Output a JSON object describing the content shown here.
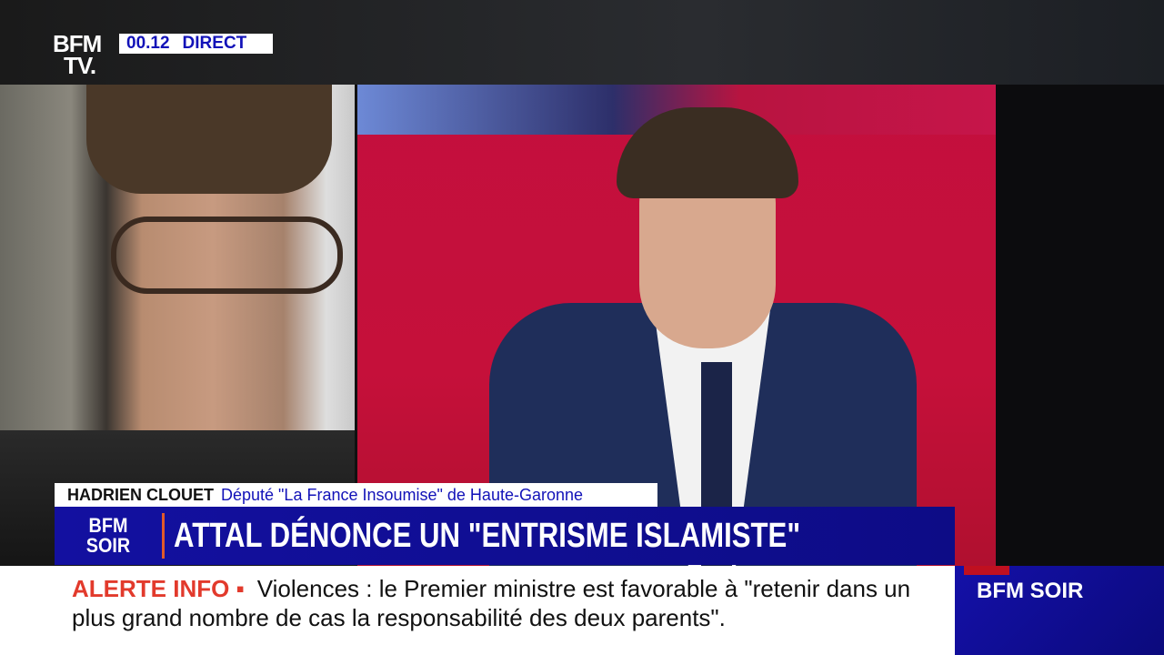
{
  "channel": {
    "logo_line1": "BFM",
    "logo_line2": "TV.",
    "time": "00.12",
    "live": "DIRECT"
  },
  "lower_third": {
    "name": "HADRIEN CLOUET",
    "title": "Député \"La France Insoumise\" de Haute-Garonne"
  },
  "headline": {
    "show_line1": "BFM",
    "show_line2": "SOIR",
    "text": "ATTAL DÉNONCE UN \"ENTRISME ISLAMISTE\""
  },
  "ticker": {
    "label": "ALERTE INFO ▪",
    "text": "Violences : le Premier ministre est favorable à \"retenir dans un plus grand nombre de cas la responsabilité des deux parents\"."
  },
  "brand": {
    "label": "BFM SOIR"
  },
  "colors": {
    "blue": "#1310a0",
    "alert": "#e23a2c",
    "studio_red": "#c30f3e"
  }
}
